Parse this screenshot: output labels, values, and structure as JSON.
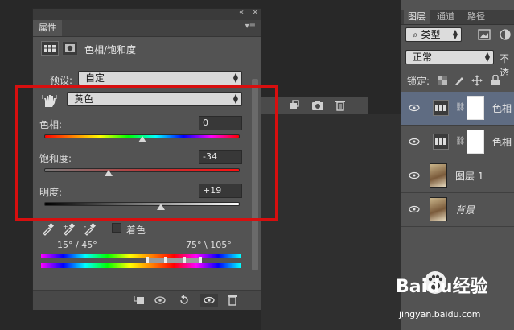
{
  "properties_panel": {
    "tab_label": "属性",
    "collapse_glyph": "«",
    "close_glyph": "×",
    "menu_glyph": "▾≡",
    "adjustment_title": "色相/饱和度",
    "preset_label": "预设:",
    "preset_value": "自定",
    "channel_value": "黄色",
    "sliders": [
      {
        "label": "色相:",
        "value": "0",
        "position": 0.5
      },
      {
        "label": "饱和度:",
        "value": "-34",
        "position": 0.33
      },
      {
        "label": "明度:",
        "value": "+19",
        "position": 0.595
      }
    ],
    "colorize_label": "着色",
    "range_left": "15° / 45°",
    "range_right": "75° \\ 105°"
  },
  "layers_panel": {
    "tabs": [
      "图层",
      "通道",
      "路径"
    ],
    "filter_type": "类型",
    "blend_mode": "正常",
    "opacity_label": "不透",
    "lock_label": "锁定:",
    "layers": [
      {
        "name": "色相",
        "type": "adjustment",
        "selected": true
      },
      {
        "name": "色相",
        "type": "adjustment",
        "selected": false
      },
      {
        "name": "图层 1",
        "type": "photo",
        "selected": false
      },
      {
        "name": "背景",
        "type": "photo",
        "selected": false,
        "italic": true
      }
    ]
  },
  "watermark": {
    "brand": "Baidu经验",
    "url": "jingyan.baidu.com"
  },
  "colors": {
    "highlight_box": "#d70f0f",
    "selected_layer": "#5f6c82",
    "panel_bg": "#535353"
  }
}
